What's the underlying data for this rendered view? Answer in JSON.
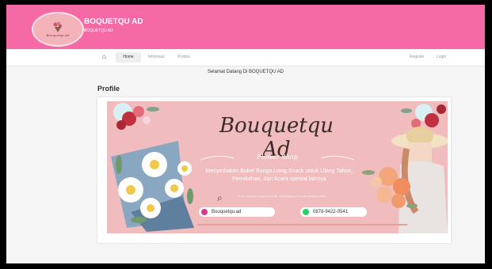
{
  "header": {
    "title": "BOQUETQU AD",
    "subtitle": "BOQUETQU AD",
    "logo_text": "Bouquetqu Ad"
  },
  "nav": {
    "home_icon": "home-icon",
    "items": [
      {
        "label": "Home"
      },
      {
        "label": "Informasi"
      },
      {
        "label": "Produk"
      }
    ],
    "register_label": "Register",
    "login_label": "Login"
  },
  "main": {
    "welcome": "Selamat Datang Di BOQUETQU AD",
    "profile_title": "Profile"
  },
  "banner": {
    "title": "Bouquetqu Ad",
    "subtitle": "Flower Shop",
    "description": "Menyediakan Buket Bunga,Uang,Snack untuk Ulang Tahun, Pernikahan, dan Acara spesial lainnya",
    "address": "Jl. KH. Sapenan, Gendang Lurus Blk. Rumah Bangsa, Kota Adat Tangerang, 15117",
    "instagram": "Bouquetqu.ad",
    "whatsapp": "0878-9422-0541"
  },
  "colors": {
    "header_pink": "#f569a5",
    "banner_pink": "#f0bcbe",
    "instagram": "#d63a8a",
    "whatsapp": "#25d366"
  }
}
